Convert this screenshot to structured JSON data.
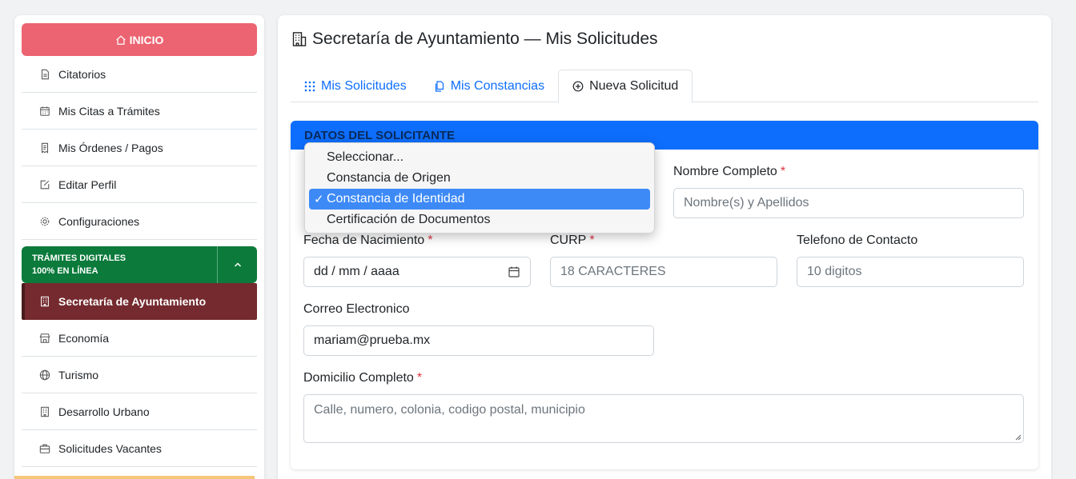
{
  "sidebar": {
    "inicio_label": "INICIO",
    "items": [
      {
        "label": "Citatorios",
        "icon": "document-icon"
      },
      {
        "label": "Mis Citas a Trámites",
        "icon": "calendar-icon"
      },
      {
        "label": "Mis Órdenes / Pagos",
        "icon": "receipt-icon"
      },
      {
        "label": "Editar Perfil",
        "icon": "edit-icon"
      },
      {
        "label": "Configuraciones",
        "icon": "gear-icon"
      }
    ],
    "tramites_line1": "TRÁMITES DIGITALES",
    "tramites_line2": "100% EN LÍNEA",
    "dept_items": [
      {
        "label": "Secretaría de Ayuntamiento",
        "icon": "building-icon",
        "active": true
      },
      {
        "label": "Economía",
        "icon": "shop-icon"
      },
      {
        "label": "Turismo",
        "icon": "globe-icon"
      },
      {
        "label": "Desarrollo Urbano",
        "icon": "building-icon"
      },
      {
        "label": "Solicitudes Vacantes",
        "icon": "briefcase-icon"
      }
    ]
  },
  "main": {
    "title": "Secretaría de Ayuntamiento — Mis Solicitudes",
    "tabs": [
      {
        "label": "Mis Solicitudes",
        "icon": "grid-icon"
      },
      {
        "label": "Mis Constancias",
        "icon": "copy-icon"
      },
      {
        "label": "Nueva Solicitud",
        "icon": "plus-circle-icon",
        "active": true
      }
    ],
    "card_header": "DATOS DEL SOLICITANTE",
    "form": {
      "nombre_label": "Nombre Completo",
      "nombre_placeholder": "Nombre(s) y Apellidos",
      "fecha_label": "Fecha de Nacimiento",
      "fecha_value": "dd / mm / aaaa",
      "curp_label": "CURP",
      "curp_placeholder": "18 CARACTERES",
      "telefono_label": "Telefono de Contacto",
      "telefono_placeholder": "10 digitos",
      "correo_label": "Correo Electronico",
      "correo_value": "mariam@prueba.mx",
      "domicilio_label": "Domicilio Completo",
      "domicilio_placeholder": "Calle, numero, colonia, codigo postal, municipio",
      "required_mark": "*"
    },
    "dropdown": {
      "options": [
        "Seleccionar...",
        "Constancia de Origen",
        "Constancia de Identidad",
        "Certificación de Documentos"
      ],
      "selected": "Constancia de Identidad",
      "check": "✓"
    }
  },
  "colors": {
    "inicio": "#ec6471",
    "tramites": "#0b7a3b",
    "active_item": "#742a2e",
    "header": "#0d6efd",
    "link": "#0d6efd",
    "selected_option": "#3d8af7"
  }
}
